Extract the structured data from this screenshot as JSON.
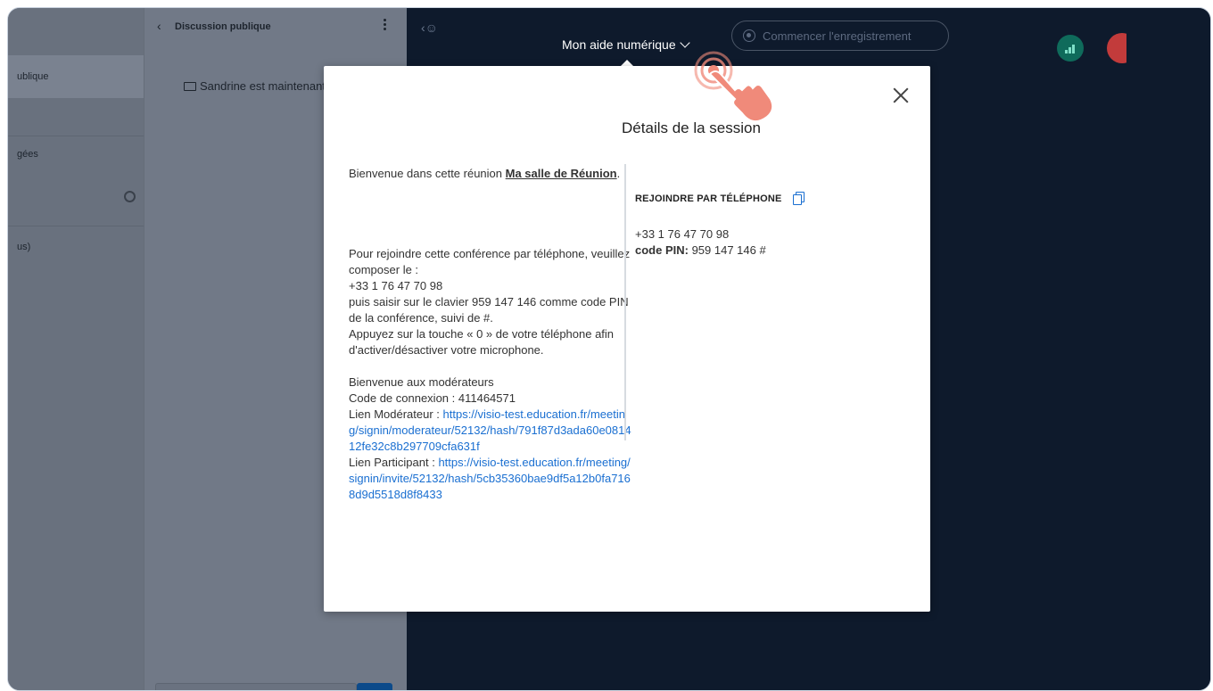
{
  "userlist": {
    "active_label": "ublique",
    "item2": "gées",
    "item3": "us)"
  },
  "chat": {
    "title": "Discussion publique",
    "message": "Sandrine est maintenant le présentateur"
  },
  "topbar": {
    "session_title": "Mon aide numérique",
    "record_label": "Commencer l'enregistrement"
  },
  "modal": {
    "title": "Détails de la session",
    "welcome_prefix": "Bienvenue dans cette réunion ",
    "room_name": "Ma salle de Réunion",
    "welcome_suffix": ".",
    "phone_instructions": "Pour rejoindre cette conférence par téléphone, veuillez composer le :",
    "phone_number": "+33 1 76 47 70 98",
    "pin_instructions": "puis saisir sur le clavier 959 147 146 comme code PIN de la conférence, suivi de #.",
    "mic_instructions": "Appuyez sur la touche « 0 » de votre téléphone afin d'activer/désactiver votre microphone.",
    "moderators_welcome": "Bienvenue aux modérateurs",
    "connection_code": "Code de connexion : 411464571",
    "moderator_link_label": "Lien Modérateur  : ",
    "moderator_link": "https://visio-test.education.fr/meeting/signin/moderateur/52132/hash/791f87d3ada60e081412fe32c8b297709cfa631f",
    "participant_link_label": "Lien Participant  : ",
    "participant_link": "https://visio-test.education.fr/meeting/signin/invite/52132/hash/5cb35360bae9df5a12b0fa7168d9d5518d8f8433",
    "right": {
      "heading": "REJOINDRE PAR TÉLÉPHONE",
      "phone_number": "+33 1 76 47 70 98",
      "pin_label": "code PIN:",
      "pin_value": " 959 147 146 #"
    }
  },
  "colors": {
    "main_bg": "#0e1a2c",
    "link": "#1a6fd1",
    "hand": "#f08a7a"
  }
}
